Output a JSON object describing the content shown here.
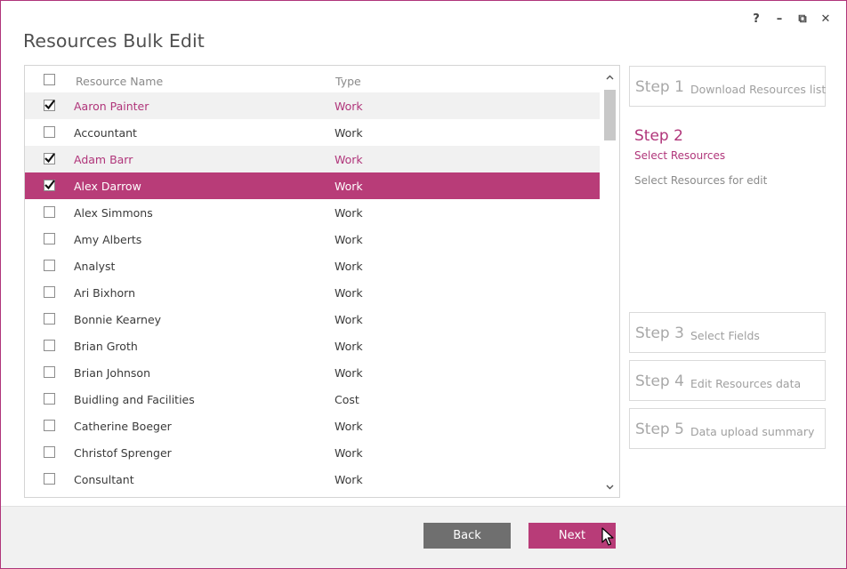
{
  "window": {
    "title": "Resources Bulk Edit",
    "controls": [
      "?",
      "–",
      "⧉",
      "✕"
    ]
  },
  "list": {
    "headers": {
      "name": "Resource Name",
      "type": "Type"
    },
    "rows": [
      {
        "name": "Aaron Painter",
        "type": "Work",
        "checked": true,
        "selected": false
      },
      {
        "name": "Accountant",
        "type": "Work",
        "checked": false,
        "selected": false
      },
      {
        "name": "Adam Barr",
        "type": "Work",
        "checked": true,
        "selected": false
      },
      {
        "name": "Alex Darrow",
        "type": "Work",
        "checked": true,
        "selected": true
      },
      {
        "name": "Alex Simmons",
        "type": "Work",
        "checked": false,
        "selected": false
      },
      {
        "name": "Amy Alberts",
        "type": "Work",
        "checked": false,
        "selected": false
      },
      {
        "name": "Analyst",
        "type": "Work",
        "checked": false,
        "selected": false
      },
      {
        "name": "Ari Bixhorn",
        "type": "Work",
        "checked": false,
        "selected": false
      },
      {
        "name": "Bonnie Kearney",
        "type": "Work",
        "checked": false,
        "selected": false
      },
      {
        "name": "Brian Groth",
        "type": "Work",
        "checked": false,
        "selected": false
      },
      {
        "name": "Brian Johnson",
        "type": "Work",
        "checked": false,
        "selected": false
      },
      {
        "name": "Buidling and Facilities",
        "type": "Cost",
        "checked": false,
        "selected": false
      },
      {
        "name": "Catherine Boeger",
        "type": "Work",
        "checked": false,
        "selected": false
      },
      {
        "name": "Christof Sprenger",
        "type": "Work",
        "checked": false,
        "selected": false
      },
      {
        "name": "Consultant",
        "type": "Work",
        "checked": false,
        "selected": false
      }
    ]
  },
  "steps": {
    "step1": {
      "num": "Step 1",
      "label": "Download Resources list"
    },
    "step2": {
      "num": "Step 2",
      "sub": "Select Resources",
      "desc": "Select Resources for edit"
    },
    "step3": {
      "num": "Step 3",
      "label": "Select Fields"
    },
    "step4": {
      "num": "Step 4",
      "label": "Edit Resources data"
    },
    "step5": {
      "num": "Step 5",
      "label": "Data upload summary"
    }
  },
  "footer": {
    "back_label": "Back",
    "next_label": "Next"
  },
  "colors": {
    "accent": "#b83c78",
    "back_button": "#6f6f6f"
  }
}
